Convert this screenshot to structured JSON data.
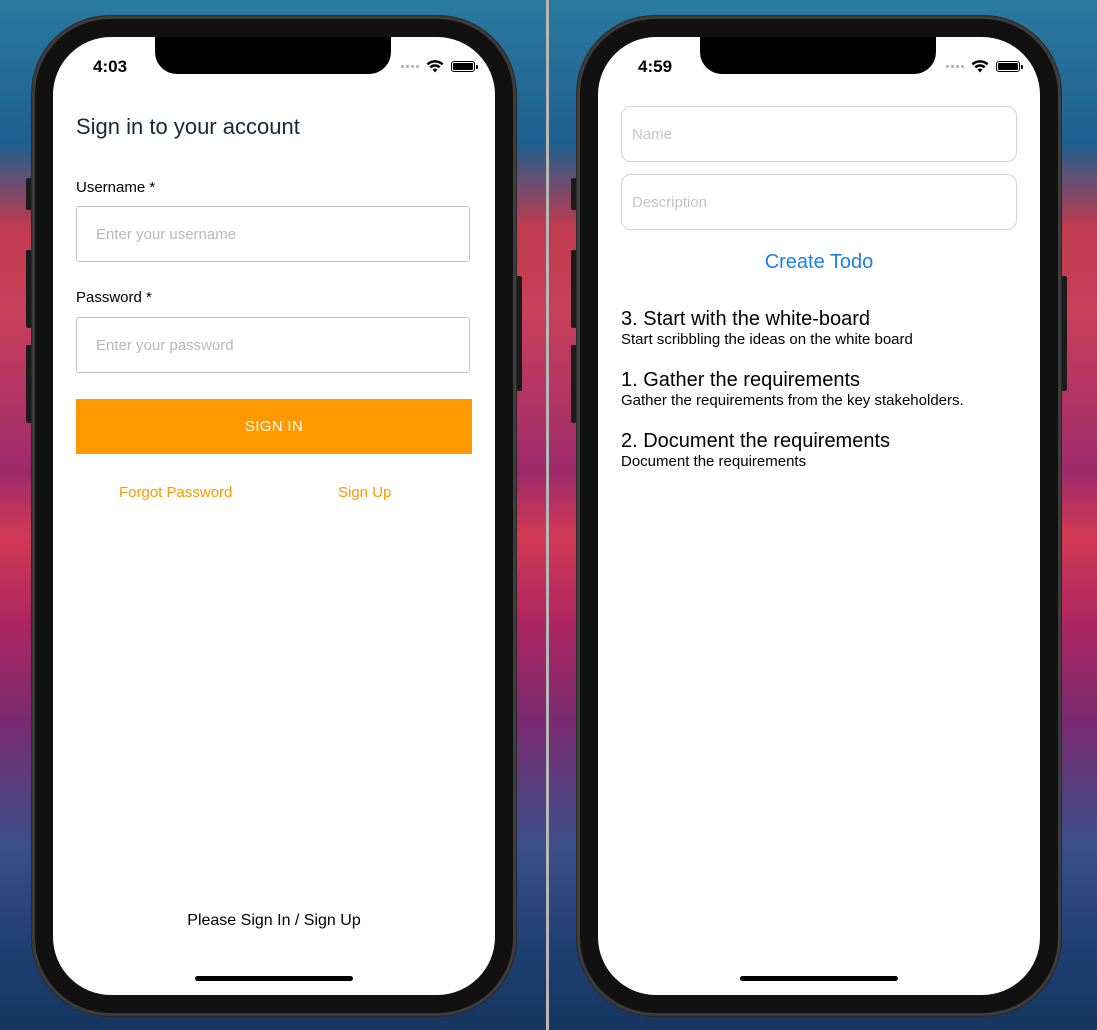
{
  "left_phone": {
    "status_time": "4:03",
    "title": "Sign in to your account",
    "username": {
      "label": "Username *",
      "placeholder": "Enter your username"
    },
    "password": {
      "label": "Password *",
      "placeholder": "Enter your password"
    },
    "sign_in_button": "SIGN IN",
    "forgot_password_link": "Forgot Password",
    "sign_up_link": "Sign Up",
    "footer": "Please Sign In / Sign Up",
    "accent_color": "#ff9900"
  },
  "right_phone": {
    "status_time": "4:59",
    "name_field": {
      "placeholder": "Name"
    },
    "description_field": {
      "placeholder": "Description"
    },
    "create_button": "Create Todo",
    "link_color": "#1a7ff0",
    "todos": [
      {
        "name": "3. Start with the white-board",
        "description": "Start scribbling the ideas on the white board"
      },
      {
        "name": "1. Gather the requirements",
        "description": "Gather the requirements from the key stakeholders."
      },
      {
        "name": "2. Document the requirements",
        "description": "Document the requirements"
      }
    ]
  },
  "icons": [
    "cellular-signal-icon",
    "wifi-icon",
    "battery-icon"
  ]
}
